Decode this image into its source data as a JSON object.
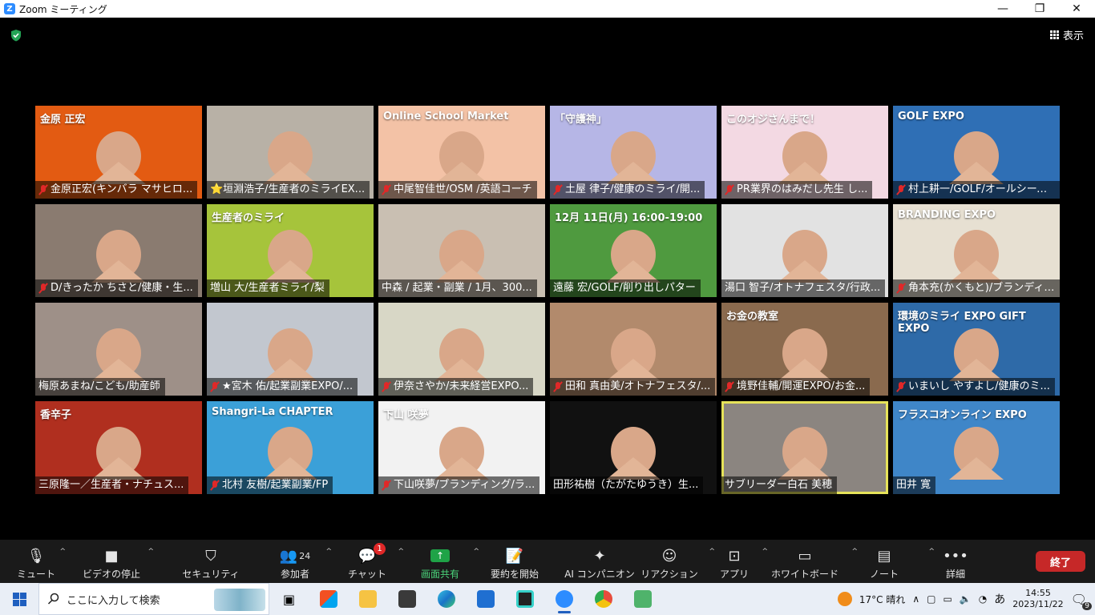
{
  "window": {
    "title": "Zoom ミーティング",
    "minimize": "—",
    "maximize": "❐",
    "close": "✕"
  },
  "header": {
    "view_label": "表示"
  },
  "participants": [
    {
      "name": "金原正宏(キンバラ マサヒロ...",
      "muted": true,
      "bg": "#e35b12",
      "banner": "金原 正宏"
    },
    {
      "name": "⭐垣淵浩子/生産者のミライEX...",
      "muted": false,
      "bg": "#b8b1a6",
      "banner": ""
    },
    {
      "name": "中尾智佳世/OSM /英語コーチ",
      "muted": true,
      "bg": "#f3c2a6",
      "banner": "Online School Market"
    },
    {
      "name": "土屋 律子/健康のミライ/開...",
      "muted": true,
      "bg": "#b6b6e6",
      "banner": "「守護神」"
    },
    {
      "name": "PR業界のはみだし先生 し...",
      "muted": true,
      "bg": "#f3d9e3",
      "banner": "このオジさんまで！"
    },
    {
      "name": "村上耕一/GOLF/オールシーズン...",
      "muted": true,
      "bg": "#2f6fb5",
      "banner": "GOLF EXPO"
    },
    {
      "name": "D/きったか ちさと/健康・生...",
      "muted": true,
      "bg": "#8a7b70",
      "banner": ""
    },
    {
      "name": "増山 大/生産者ミライ/梨",
      "muted": false,
      "bg": "#a6c43b",
      "banner": "生産者のミライ"
    },
    {
      "name": "中森 / 起業・副業 / 1月、300...",
      "muted": false,
      "bg": "#c9bfb2",
      "banner": ""
    },
    {
      "name": "遠藤 宏/GOLF/削り出しパター",
      "muted": false,
      "bg": "#4f9a3f",
      "banner": "12月 11日(月) 16:00-19:00"
    },
    {
      "name": "湯口 智子/オトナフェスタ/行政...",
      "muted": false,
      "bg": "#e2e2e2",
      "banner": ""
    },
    {
      "name": "角本充(かくもと)/ブランディン...",
      "muted": true,
      "bg": "#e7e0d2",
      "banner": "BRANDING EXPO"
    },
    {
      "name": "梅原あまね/こども/助産師",
      "muted": false,
      "bg": "#9e9088",
      "banner": ""
    },
    {
      "name": "★宮木 佑/起業副業EXPO/...",
      "muted": true,
      "bg": "#c2c7cf",
      "banner": ""
    },
    {
      "name": "伊奈さやか/未来経営EXPO...",
      "muted": true,
      "bg": "#d8d7c6",
      "banner": ""
    },
    {
      "name": "田和 真由美/オトナフェスタ/...",
      "muted": true,
      "bg": "#b28a6c",
      "banner": ""
    },
    {
      "name": "境野佳輔/開運EXPO/お金...",
      "muted": true,
      "bg": "#8a6a4e",
      "banner": "お金の教室"
    },
    {
      "name": "いまいし やすよし/健康のミ...",
      "muted": true,
      "bg": "#2e6aa8",
      "banner": "環境のミライ EXPO  GIFT EXPO"
    },
    {
      "name": "三原隆一／生産者・ナチュス...",
      "muted": false,
      "bg": "#b02f1f",
      "banner": "香辛子"
    },
    {
      "name": "北村 友樹/起業副業/FP",
      "muted": true,
      "bg": "#3ba0d8",
      "banner": "Shangri-La CHAPTER"
    },
    {
      "name": "下山咲夢/ブランディング/ラ...",
      "muted": true,
      "bg": "#f2f2f2",
      "banner": "下山 咲夢"
    },
    {
      "name": "田形祐樹（たがたゆうき）生...",
      "muted": false,
      "bg": "#111111",
      "banner": ""
    },
    {
      "name": "サブリーダー白石 美穂",
      "muted": false,
      "bg": "#8b8580",
      "banner": "",
      "active": true
    },
    {
      "name": "田井 寛",
      "muted": false,
      "bg": "#3f86c8",
      "banner": "フラスコオンライン EXPO"
    }
  ],
  "toolbar": {
    "mute": "ミュート",
    "video": "ビデオの停止",
    "security": "セキュリティ",
    "participants": "参加者",
    "participants_count": "24",
    "chat": "チャット",
    "chat_badge": "1",
    "share": "画面共有",
    "summary": "要約を開始",
    "ai": "AI コンパニオン",
    "reactions": "リアクション",
    "apps": "アプリ",
    "whiteboard": "ホワイトボード",
    "notes": "ノート",
    "more": "詳細",
    "end": "終了"
  },
  "taskbar": {
    "search_placeholder": "ここに入力して検索",
    "weather": "17°C  晴れ",
    "ime": "あ",
    "time": "14:55",
    "date": "2023/11/22",
    "notifications": "9"
  },
  "colors": {
    "accent_green": "#1fa347",
    "end_red": "#c62828",
    "zoom_blue": "#2D8CFF",
    "active_border": "#e6e35a"
  }
}
